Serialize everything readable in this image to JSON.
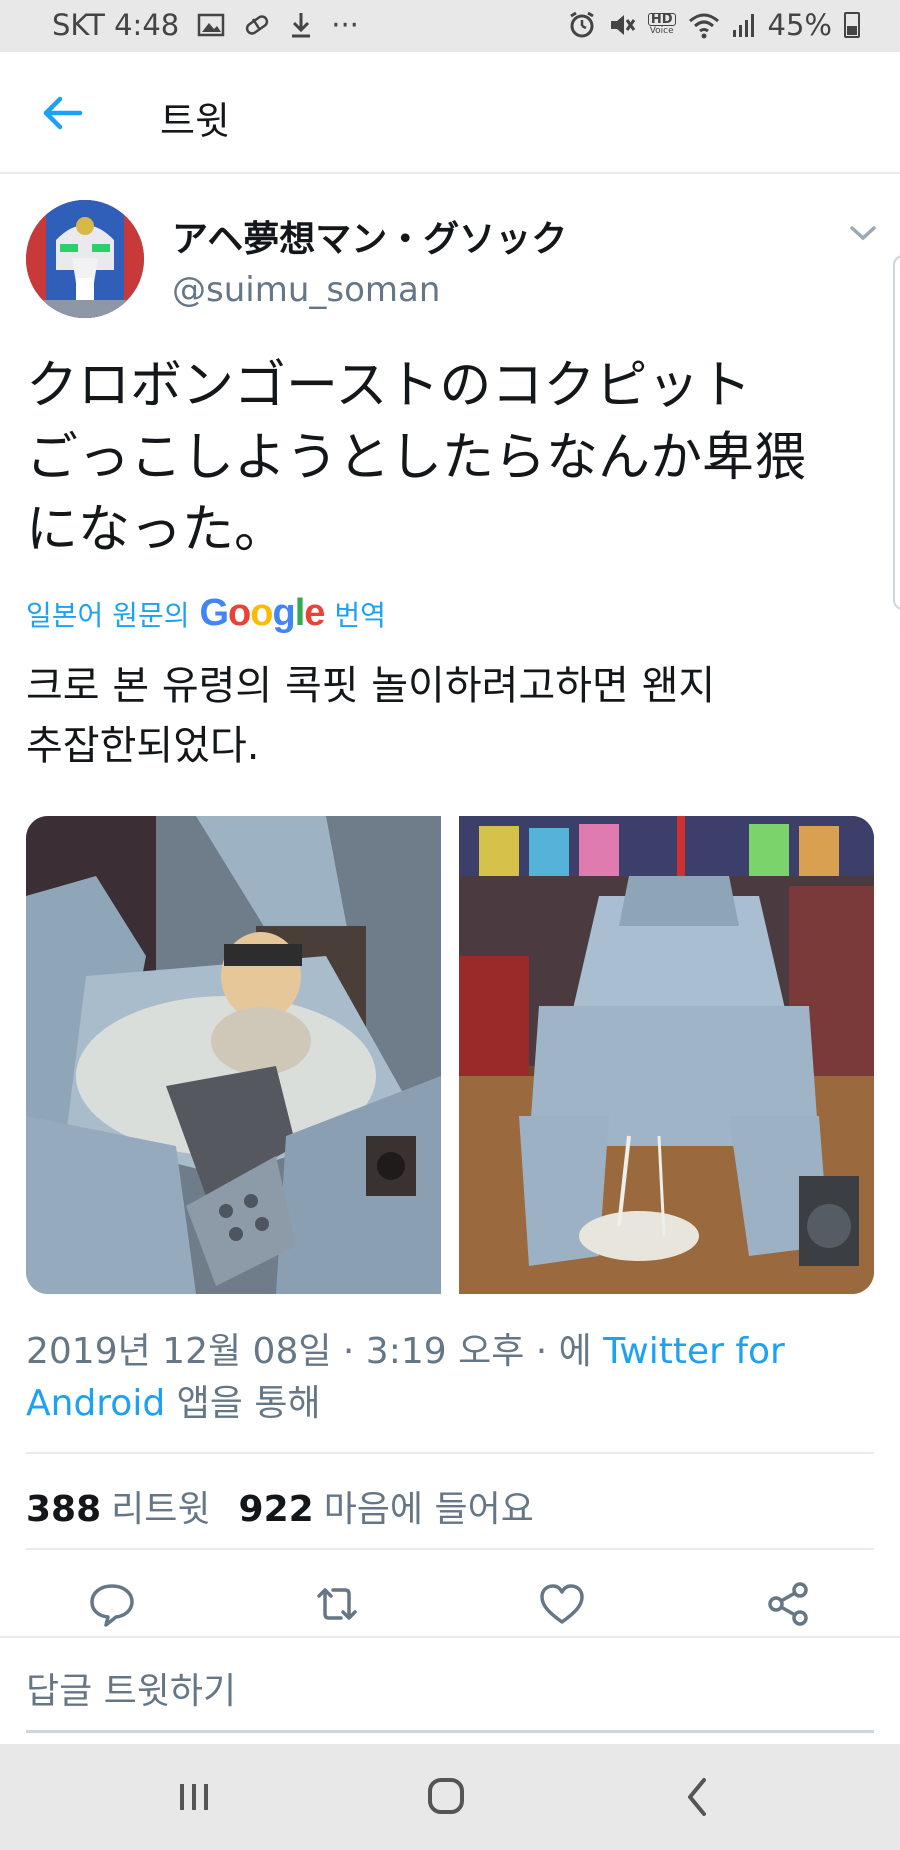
{
  "status_bar": {
    "carrier_time": "SKT 4:48",
    "overflow": "···",
    "hd_badge": "HD",
    "hd_sub": "Voice",
    "battery": "45%"
  },
  "header": {
    "title": "트윗"
  },
  "tweet": {
    "display_name": "アヘ夢想マン・グソック",
    "handle": "@suimu_soman",
    "text_lines": [
      "クロボンゴーストのコクピット",
      "ごっこしようとしたらなんか卑猥",
      "になった。"
    ],
    "translate_prefix": "일본어 원문의",
    "translate_google_letters": [
      "G",
      "o",
      "o",
      "g",
      "l",
      "e"
    ],
    "translate_suffix": "번역",
    "translation_lines": [
      "크로 본 유령의 콕핏 놀이하려고하면 왠지",
      "추잡한되었다."
    ],
    "timestamp_prefix": "2019년 12월 08일 · 3:19 오후 · 에",
    "source_link": "Twitter for Android",
    "timestamp_suffix": "앱을 통해",
    "retweets_count": "388",
    "retweets_label": "리트윗",
    "likes_count": "922",
    "likes_label": "마음에 들어요"
  },
  "reply": {
    "placeholder": "답글 트윗하기"
  },
  "colors": {
    "accent": "#1da1f2",
    "text": "#14171a",
    "muted": "#657786",
    "google": [
      "#4285f4",
      "#ea4335",
      "#fbbc05",
      "#4285f4",
      "#34a853",
      "#ea4335"
    ]
  },
  "icons": {
    "back": "arrow-left-icon",
    "caret": "chevron-down-icon",
    "reply": "speech-bubble-icon",
    "retweet": "retweet-icon",
    "like": "heart-icon",
    "share": "share-icon",
    "nav_recents": "recents-icon",
    "nav_home": "home-icon",
    "nav_back": "nav-back-icon"
  }
}
